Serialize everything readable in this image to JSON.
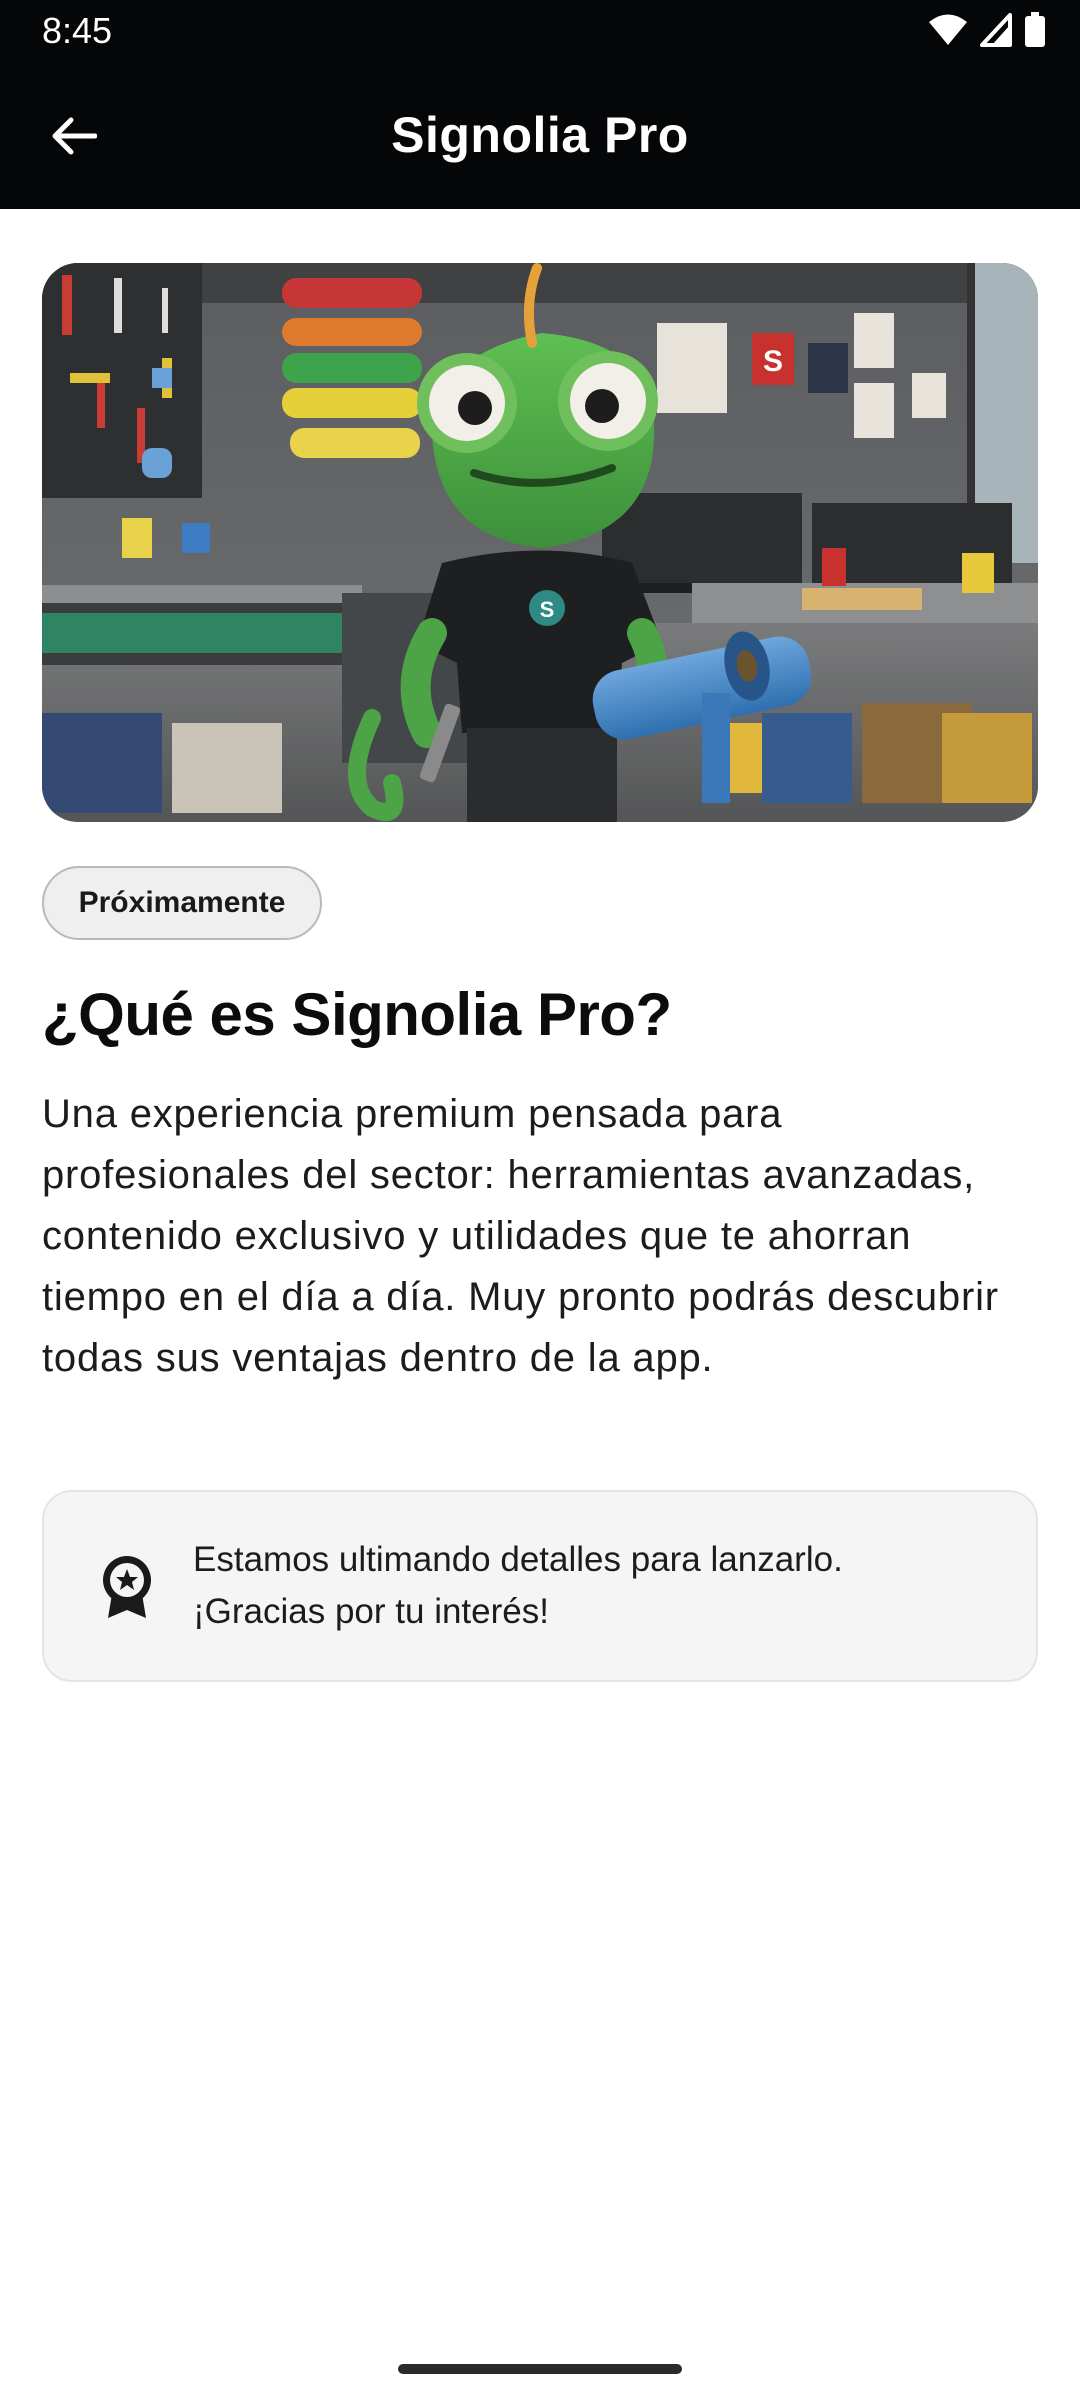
{
  "status_bar": {
    "time": "8:45",
    "icons": [
      "wifi-icon",
      "signal-icon",
      "battery-icon"
    ]
  },
  "app_bar": {
    "title": "Signolia Pro",
    "back_icon": "arrow-left-icon"
  },
  "hero": {
    "description": "hero-illustration"
  },
  "content": {
    "chip_label": "Próximamente",
    "heading": "¿Qué es Signolia Pro?",
    "description": "Una experiencia premium pensada para profesionales del sector: herramientas avanzadas, contenido exclusivo y utilidades que te ahorran tiempo en el día a día. Muy pronto podrás descubrir todas sus ventajas dentro de la app."
  },
  "info_card": {
    "icon": "award-badge-icon",
    "line1": "Estamos ultimando detalles para lanzarlo.",
    "line2": "¡Gracias por tu interés!"
  },
  "colors": {
    "app_bar_bg": "#050607",
    "chip_bg": "#efefef",
    "card_bg": "#f5f5f5"
  }
}
